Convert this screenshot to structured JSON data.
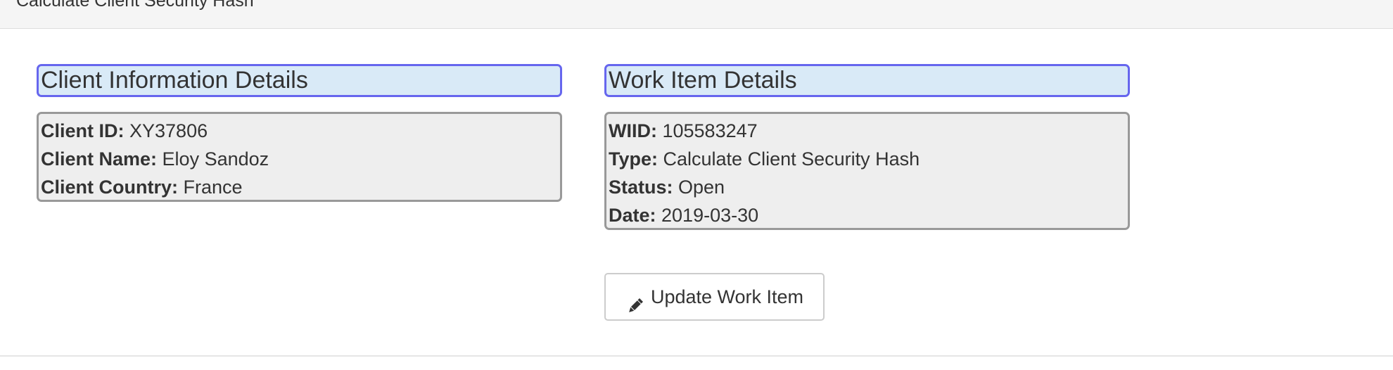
{
  "header": {
    "title": "Calculate Client Security Hash"
  },
  "client_panel": {
    "heading": "Client Information Details",
    "fields": [
      {
        "label": "Client ID:",
        "value": "XY37806"
      },
      {
        "label": "Client Name:",
        "value": "Eloy Sandoz"
      },
      {
        "label": "Client Country:",
        "value": "France"
      }
    ]
  },
  "work_panel": {
    "heading": "Work Item Details",
    "fields": [
      {
        "label": "WIID:",
        "value": "105583247"
      },
      {
        "label": "Type:",
        "value": "Calculate Client Security Hash"
      },
      {
        "label": "Status:",
        "value": "Open"
      },
      {
        "label": "Date:",
        "value": "2019-03-30"
      }
    ]
  },
  "actions": {
    "update_label": "Update Work Item",
    "update_icon": "pencil-icon"
  },
  "colors": {
    "heading_bg": "#d9eaf7",
    "heading_border": "#6666ee",
    "body_bg": "#eeeeee",
    "body_border": "#999999"
  }
}
